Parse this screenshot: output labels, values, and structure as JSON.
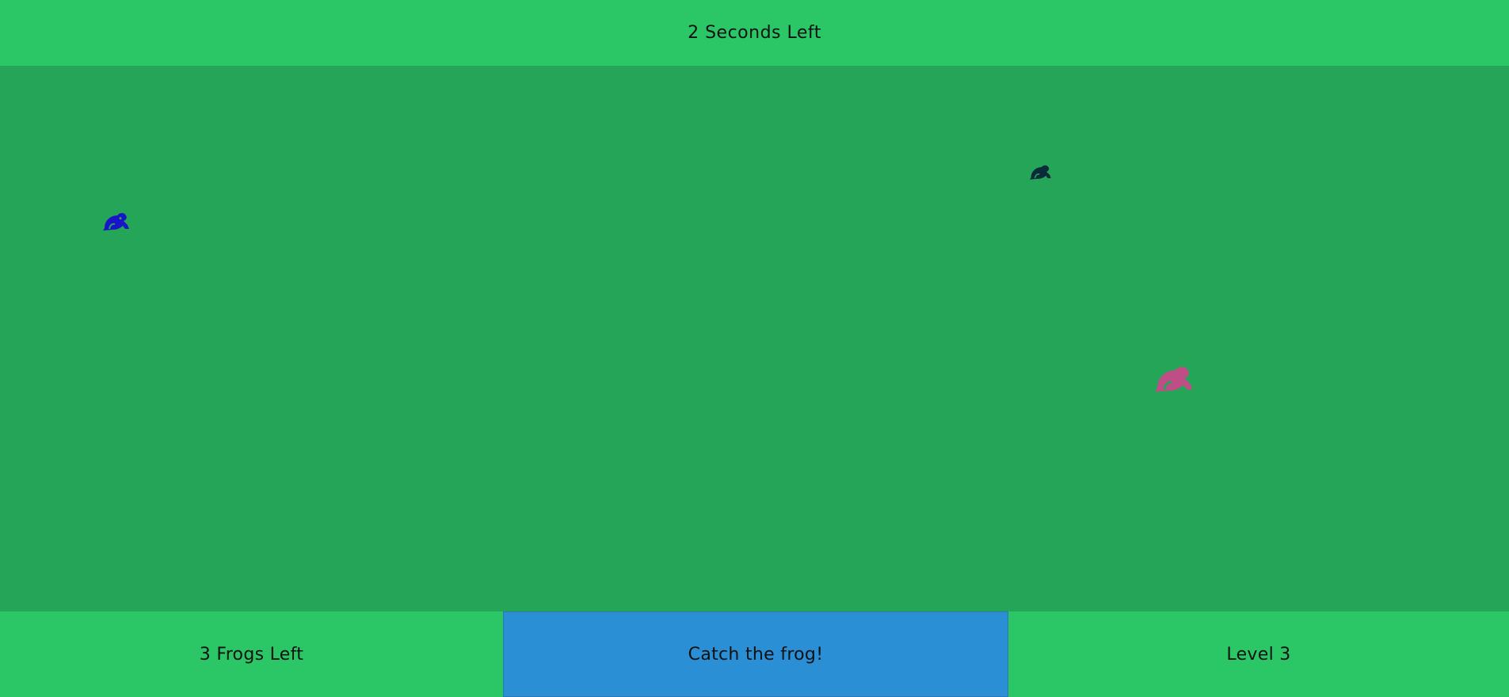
{
  "header": {
    "timer_text": "2 Seconds Left"
  },
  "field": {
    "frogs": [
      {
        "name": "frog-icon",
        "color": "#1a14c9"
      },
      {
        "name": "frog-icon",
        "color": "#0b2a3a"
      },
      {
        "name": "frog-icon",
        "color": "#c04e86"
      }
    ]
  },
  "footer": {
    "frogs_left_text": "3 Frogs Left",
    "action_label": "Catch the frog!",
    "level_text": "Level 3"
  },
  "colors": {
    "header_bg": "#2bc767",
    "field_bg": "#24a558",
    "button_bg": "#2b8fd6"
  }
}
